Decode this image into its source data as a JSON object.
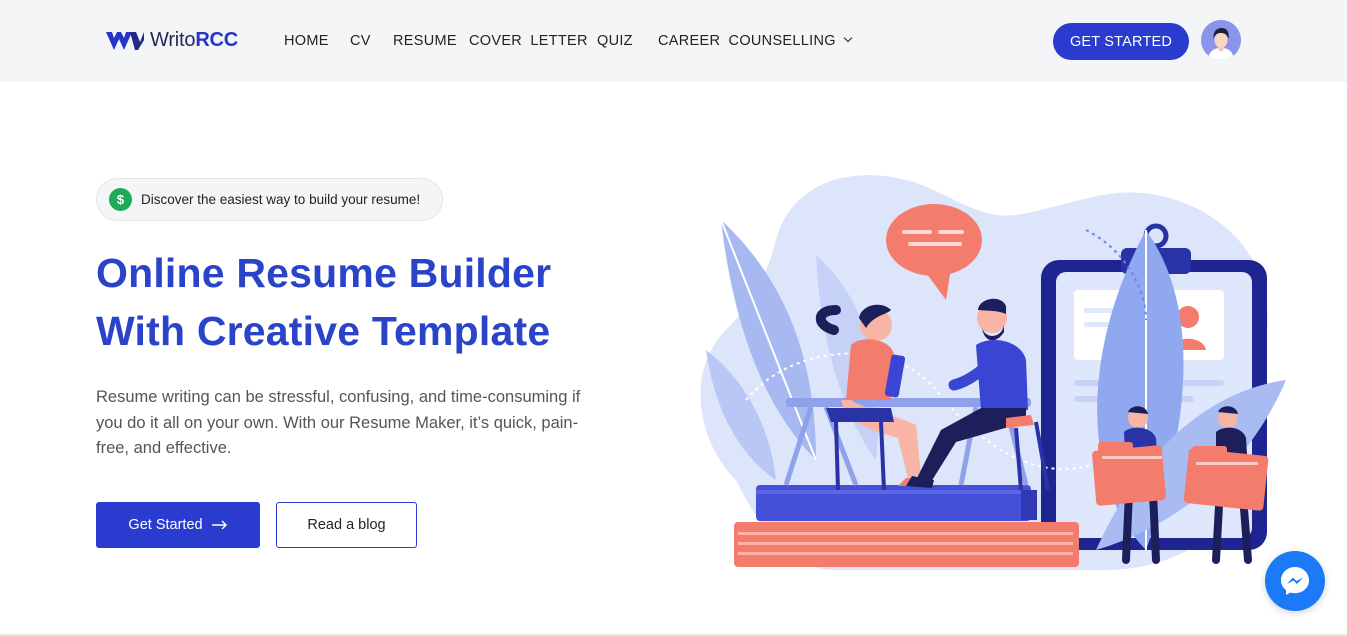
{
  "header": {
    "logo": {
      "text_plain": "Writo",
      "text_bold": "RCC"
    },
    "nav": [
      {
        "label": "HOME"
      },
      {
        "label": "CV"
      },
      {
        "label": "RESUME"
      },
      {
        "label": "COVER LETTER"
      },
      {
        "label": "QUIZ"
      },
      {
        "label": "CAREER COUNSELLING",
        "has_dropdown": true
      }
    ],
    "cta_label": "GET STARTED",
    "avatar_icon": "user-avatar"
  },
  "hero": {
    "pill": {
      "icon": "dollar-icon",
      "icon_glyph": "$",
      "text": "Discover the easiest way to build your resume!"
    },
    "title_line1": "Online Resume Builder",
    "title_line2": "With Creative Template",
    "description": "Resume writing can be stressful, confusing, and time-consuming if you do it all on your own. With our Resume Maker, it’s quick, pain-free, and effective.",
    "primary_button": "Get Started",
    "secondary_button": "Read a blog"
  },
  "colors": {
    "brand": "#2a3bcf",
    "title": "#2a44c9",
    "header_bg": "#f3f5f7",
    "messenger": "#1a7af7",
    "pill_icon": "#1faa59"
  },
  "floating": {
    "messenger_icon": "messenger-icon"
  }
}
